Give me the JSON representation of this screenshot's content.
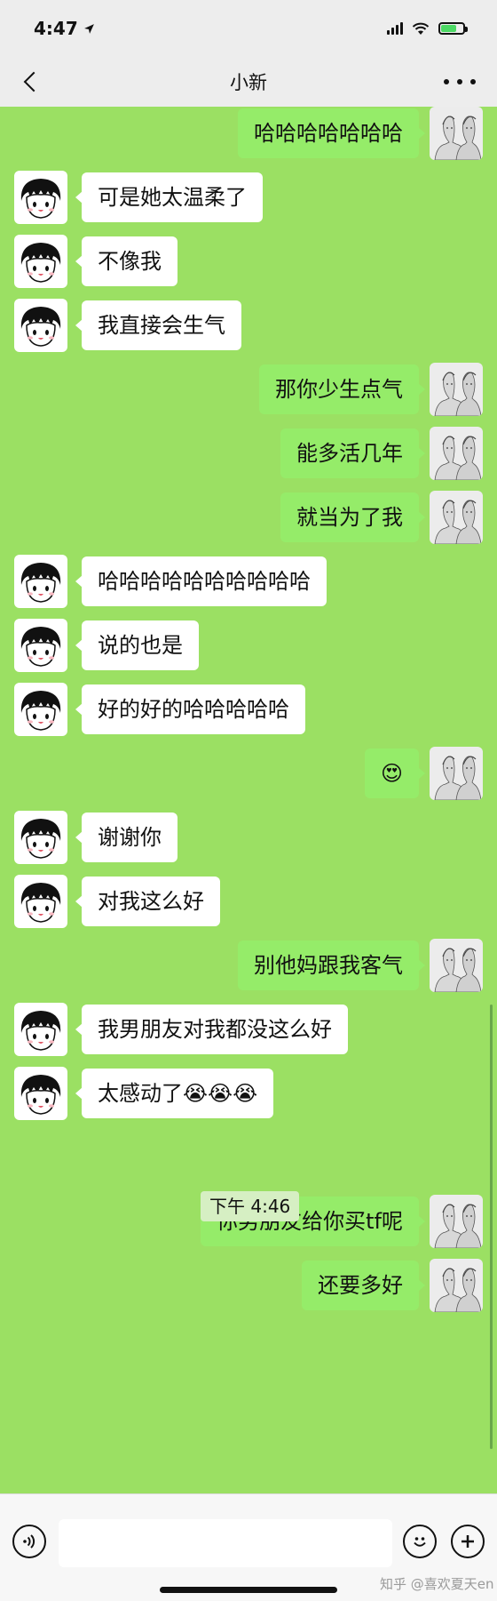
{
  "status_bar": {
    "time": "4:47",
    "battery_level": 0.7
  },
  "nav": {
    "title": "小新"
  },
  "messages": [
    {
      "side": "right",
      "text": "哈哈哈哈哈哈哈"
    },
    {
      "side": "left",
      "text": "可是她太温柔了"
    },
    {
      "side": "left",
      "text": "不像我"
    },
    {
      "side": "left",
      "text": "我直接会生气"
    },
    {
      "side": "right",
      "text": "那你少生点气"
    },
    {
      "side": "right",
      "text": "能多活几年"
    },
    {
      "side": "right",
      "text": "就当为了我"
    },
    {
      "side": "left",
      "text": "哈哈哈哈哈哈哈哈哈哈"
    },
    {
      "side": "left",
      "text": "说的也是"
    },
    {
      "side": "left",
      "text": "好的好的哈哈哈哈哈"
    },
    {
      "side": "right",
      "text": "😍"
    },
    {
      "side": "left",
      "text": "谢谢你"
    },
    {
      "side": "left",
      "text": "对我这么好"
    },
    {
      "side": "right",
      "text": "别他妈跟我客气"
    },
    {
      "side": "left",
      "text": "我男朋友对我都没这么好"
    },
    {
      "side": "left",
      "text": "太感动了😭😭😭"
    },
    {
      "side": "right",
      "text": "你男朋友给你买tf呢"
    },
    {
      "side": "right",
      "text": "还要多好"
    }
  ],
  "timestamp": "下午 4:46",
  "input": {
    "placeholder": ""
  },
  "watermark": "知乎 @喜欢夏天en",
  "colors": {
    "chat_background": "#9be063",
    "outgoing_bubble": "#95ec69",
    "incoming_bubble": "#ffffff"
  },
  "icons": {
    "back": "chevron-left-icon",
    "more": "more-dots-icon",
    "voice": "voice-icon",
    "emoji": "emoji-icon",
    "add": "plus-icon"
  }
}
